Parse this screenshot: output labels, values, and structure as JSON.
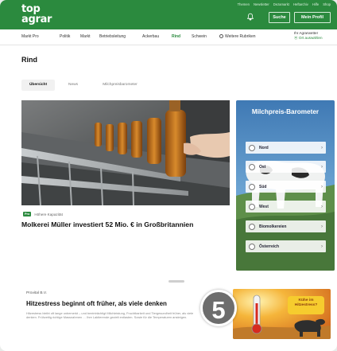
{
  "header": {
    "logo_line1": "top",
    "logo_line2": "agrar",
    "top_links": [
      "Themen",
      "Newsletter",
      "Dezamarkt",
      "Heftarchiv",
      "Hilfe",
      "Shop"
    ],
    "search_label": "Suche",
    "profile_label": "Mein Profil",
    "brand_color": "#2b8a3e"
  },
  "nav": {
    "items": [
      "Markt Pro",
      "Politik",
      "Markt",
      "Betriebsleitung",
      "Ackerbau",
      "Rind",
      "Schwein",
      "Weitere Rubriken"
    ],
    "active": "Rind",
    "right_title": "Ihr Agrarwetter",
    "right_sub": "Ort auswählen"
  },
  "page": {
    "title": "Rind",
    "tabs": [
      "Übersicht",
      "News",
      "Milchpreisbarometer"
    ],
    "active_tab": "Übersicht"
  },
  "hero": {
    "tag": "Pro",
    "tag_label": "Höhere Kapazität",
    "headline": "Molkerei Müller investiert 52 Mio. € in Großbritannien"
  },
  "barometer": {
    "title": "Milchpreis-Barometer",
    "regions": [
      "Nord",
      "Ost",
      "Süd",
      "West",
      "Biomolkereien",
      "Österreich"
    ]
  },
  "ad": {
    "sponsor": "Provital B.V.",
    "title": "Hitzestress beginnt oft früher, als viele denken",
    "text": "Hitzestress bleibt oft lange unbemerkt – und beeinträchtigt Milchleistung, Fruchtbarkeit und Tiergesundheit früher, als viele denken. Frühzeitig richtige Massnahmen … Ihre Laktierende gezielt entlasten. Sowie für die Temperaturen ansteigen.",
    "bubble": "Kühe im Hitzestress?",
    "badge": "5"
  }
}
